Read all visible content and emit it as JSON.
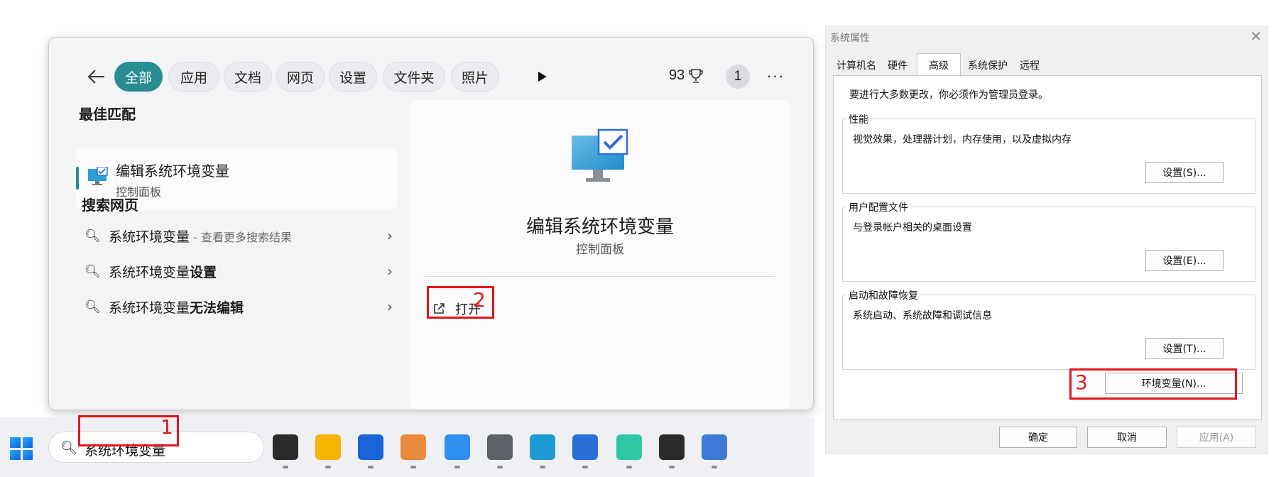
{
  "search_panel": {
    "filters": [
      "全部",
      "应用",
      "文档",
      "网页",
      "设置",
      "文件夹",
      "照片"
    ],
    "points": "93",
    "badge": "1",
    "more": "···",
    "best_match_title": "最佳匹配",
    "best_match": {
      "name": "编辑系统环境变量",
      "subtitle": "控制面板"
    },
    "web_title": "搜索网页",
    "web_results": [
      {
        "term": "系统环境变量",
        "bold": "",
        "hint": " - 查看更多搜索结果"
      },
      {
        "term": "系统环境变量",
        "bold": "设置",
        "hint": ""
      },
      {
        "term": "系统环境变量",
        "bold": "无法编辑",
        "hint": ""
      }
    ],
    "detail": {
      "name": "编辑系统环境变量",
      "subtitle": "控制面板",
      "open_label": "打开"
    }
  },
  "annotations": {
    "step1": "1",
    "step2": "2",
    "step3": "3"
  },
  "taskbar": {
    "search_query": "系统环境变量",
    "apps": [
      {
        "name": "task-view-icon",
        "color": "#2b2b2b"
      },
      {
        "name": "file-explorer-icon",
        "color": "#f4b400"
      },
      {
        "name": "kugou-icon",
        "color": "#1a63d8"
      },
      {
        "name": "paint-icon",
        "color": "#e9893b"
      },
      {
        "name": "qq-browser-icon",
        "color": "#2f8ff0"
      },
      {
        "name": "camera-icon",
        "color": "#5d6168"
      },
      {
        "name": "edge-icon",
        "color": "#1c9bd6"
      },
      {
        "name": "photos-icon",
        "color": "#2a6fd6"
      },
      {
        "name": "bit-app-icon",
        "color": "#2fc7a4"
      },
      {
        "name": "terminal-icon",
        "color": "#2b2b2b"
      },
      {
        "name": "network-icon",
        "color": "#3d7ad6"
      }
    ]
  },
  "system_properties": {
    "title": "系统属性",
    "tabs": [
      "计算机名",
      "硬件",
      "高级",
      "系统保护",
      "远程"
    ],
    "active_tab": "高级",
    "notice": "要进行大多数更改，你必须作为管理员登录。",
    "groups": [
      {
        "label": "性能",
        "desc": "视觉效果，处理器计划，内存使用，以及虚拟内存",
        "button": "设置(S)..."
      },
      {
        "label": "用户配置文件",
        "desc": "与登录帐户相关的桌面设置",
        "button": "设置(E)..."
      },
      {
        "label": "启动和故障恢复",
        "desc": "系统启动、系统故障和调试信息",
        "button": "设置(T)..."
      }
    ],
    "env_button": "环境变量(N)...",
    "ok": "确定",
    "cancel": "取消",
    "apply": "应用(A)"
  }
}
